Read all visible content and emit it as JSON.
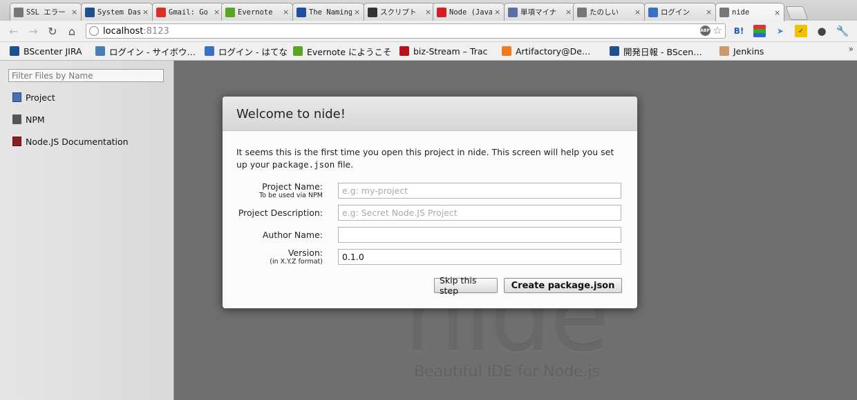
{
  "tabs": [
    {
      "title": "SSL エラー",
      "icon": "globe-icon",
      "color": "#777777",
      "active": false
    },
    {
      "title": "System Dash",
      "icon": "jira-icon",
      "color": "#1f4f8c",
      "active": false
    },
    {
      "title": "Gmail: Go",
      "icon": "gmail-icon",
      "color": "#d93025",
      "active": false
    },
    {
      "title": "Evernote",
      "icon": "evernote-icon",
      "color": "#5ba525",
      "active": false
    },
    {
      "title": "The Naming",
      "icon": "m-icon",
      "color": "#1d4f9e",
      "active": false
    },
    {
      "title": "スクリプト",
      "icon": "hat-icon",
      "color": "#333333",
      "active": false
    },
    {
      "title": "Node (Java",
      "icon": "oracle-icon",
      "color": "#d21f26",
      "active": false
    },
    {
      "title": "単項マイナ",
      "icon": "grid-icon",
      "color": "#5b6ea8",
      "active": false
    },
    {
      "title": "たのしい",
      "icon": "globe-icon",
      "color": "#777777",
      "active": false
    },
    {
      "title": "ログイン",
      "icon": "hatena-icon",
      "color": "#3b6fc4",
      "active": false
    },
    {
      "title": "nide",
      "icon": "globe-icon",
      "color": "#777777",
      "active": true
    }
  ],
  "omnibox": {
    "host": "localhost",
    "port": ":8123",
    "abp": "ABP"
  },
  "bookmarks": [
    {
      "label": "BScenter JIRA",
      "icon": "jira-icon",
      "color": "#1f4f8c"
    },
    {
      "label": "ログイン - サイボウ…",
      "icon": "cybozu-icon",
      "color": "#4a7fb5"
    },
    {
      "label": "ログイン - はてな",
      "icon": "hatena-icon",
      "color": "#3b6fc4"
    },
    {
      "label": "Evernote にようこそ",
      "icon": "evernote-icon",
      "color": "#5ba525"
    },
    {
      "label": "biz-Stream – Trac",
      "icon": "trac-icon",
      "color": "#b5121b"
    },
    {
      "label": "Artifactory@De…",
      "icon": "artifactory-icon",
      "color": "#f07b1d"
    },
    {
      "label": "開発日報 - BScen…",
      "icon": "confluence-icon",
      "color": "#1f4f8c"
    },
    {
      "label": "Jenkins",
      "icon": "jenkins-icon",
      "color": "#c99a6b"
    }
  ],
  "sidebar": {
    "filter_placeholder": "Filter Files by Name",
    "items": [
      {
        "label": "Project",
        "icon": "project-icon"
      },
      {
        "label": "NPM",
        "icon": "npm-icon"
      },
      {
        "label": "Node.JS Documentation",
        "icon": "book-icon"
      }
    ]
  },
  "background": {
    "logo": "nide",
    "tagline": "Beautiful IDE for Node.js"
  },
  "dialog": {
    "title": "Welcome to nide!",
    "intro_a": "It seems this is the first time you open this project in nide. This screen will help you set up your ",
    "intro_code": "package.json",
    "intro_b": " file.",
    "fields": {
      "name": {
        "label": "Project Name:",
        "hint": "To be used via NPM",
        "placeholder": "e.g: my-project",
        "value": ""
      },
      "description": {
        "label": "Project Description:",
        "placeholder": "e.g: Secret Node.JS Project",
        "value": ""
      },
      "author": {
        "label": "Author Name:",
        "placeholder": "",
        "value": ""
      },
      "version": {
        "label": "Version:",
        "hint": "(in X.Y.Z format)",
        "placeholder": "",
        "value": "0.1.0"
      }
    },
    "skip_label": "Skip this step",
    "create_label": "Create package.json"
  }
}
